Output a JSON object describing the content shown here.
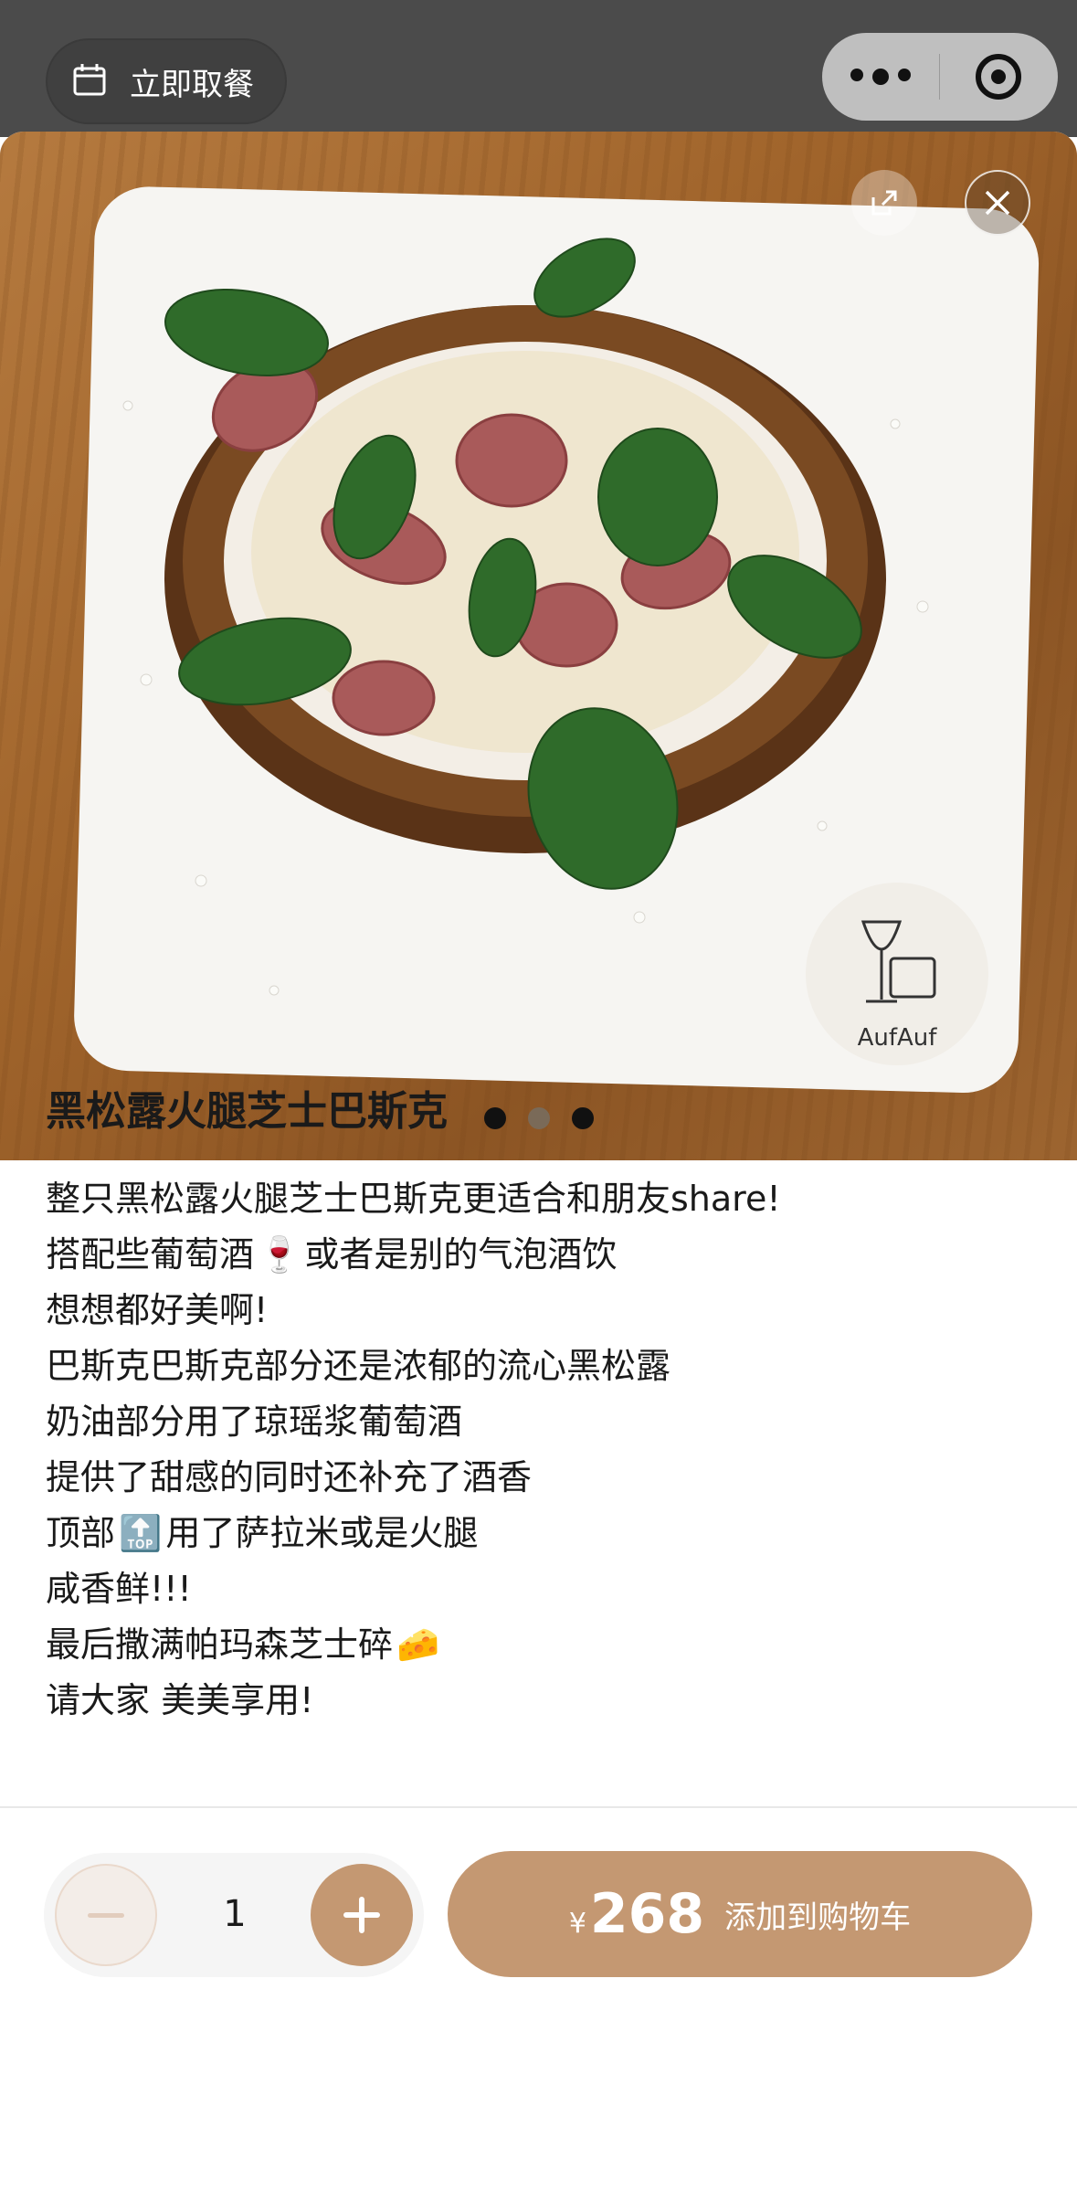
{
  "topbar": {
    "pickup_label": "立即取餐",
    "more_icon": "more-dots-icon",
    "target_icon": "target-circle-icon"
  },
  "photo": {
    "logo_text": "AufAuf",
    "pager_total": 3,
    "share_icon": "share-external-icon",
    "close_icon": "close-icon"
  },
  "product": {
    "title": "黑松露火腿芝士巴斯克",
    "desc": [
      {
        "text": "整只黑松露火腿芝士巴斯克更适合和朋友share!"
      },
      {
        "text": "搭配些葡萄酒",
        "emoji": "🍷",
        "after": "或者是别的气泡酒饮"
      },
      {
        "text": "想想都好美啊!"
      },
      {
        "text": "巴斯克巴斯克部分还是浓郁的流心黑松露"
      },
      {
        "text": "奶油部分用了琼瑶浆葡萄酒"
      },
      {
        "text": "提供了甜感的同时还补充了酒香"
      },
      {
        "text": "顶部",
        "emoji": "🔝",
        "after": "用了萨拉米或是火腿"
      },
      {
        "text": "咸香鲜!!!"
      },
      {
        "text": "最后撒满帕玛森芝士碎",
        "emoji": "🧀"
      },
      {
        "text": "请大家 美美享用!"
      }
    ]
  },
  "cart": {
    "quantity": "1",
    "currency": "¥",
    "price": "268",
    "add_label": "添加到购物车"
  },
  "colors": {
    "accent": "#c49872",
    "text": "#1a1a1a"
  }
}
